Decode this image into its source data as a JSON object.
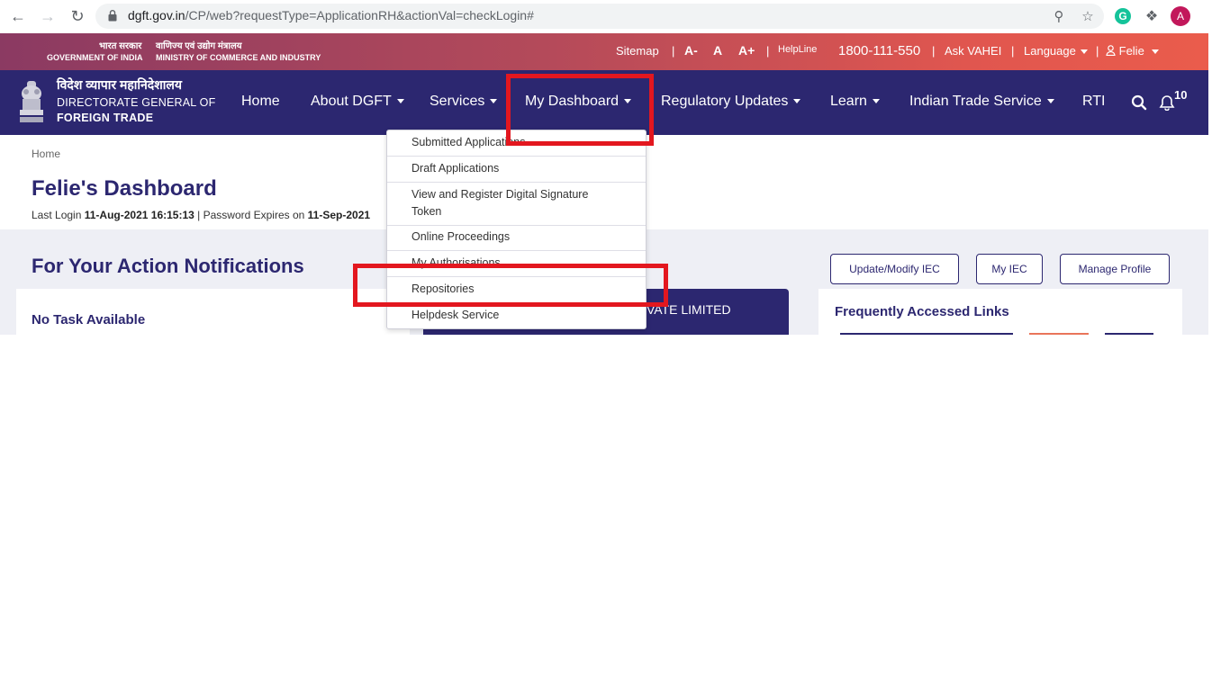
{
  "browser": {
    "url_host": "dgft.gov.in",
    "url_path": "/CP/web?requestType=ApplicationRH&actionVal=checkLogin#",
    "profile_initial": "A"
  },
  "gov_strip": {
    "hindi_govt": "भारत सरकार",
    "hindi_ministry": "वाणिज्य एवं उद्योग मंत्रालय",
    "govt": "GOVERNMENT OF INDIA",
    "ministry": "MINISTRY OF COMMERCE AND INDUSTRY",
    "sitemap": "Sitemap",
    "font_small": "A-",
    "font_normal": "A",
    "font_large": "A+",
    "helpline_label": "HelpLine",
    "helpline_number": "1800-111-550",
    "ask": "Ask VAHEI",
    "language": "Language",
    "user": "Felie",
    "sep": "|"
  },
  "brand": {
    "hindi": "विदेश व्यापार महानिदेशालय",
    "line2": "DIRECTORATE GENERAL OF",
    "line3": "FOREIGN TRADE"
  },
  "nav": {
    "home": "Home",
    "about": "About DGFT",
    "services": "Services",
    "dashboard": "My Dashboard",
    "regulatory": "Regulatory Updates",
    "learn": "Learn",
    "its": "Indian Trade Service",
    "rti": "RTI",
    "notif_count": "10"
  },
  "dropdown": {
    "items": [
      "Submitted Applications",
      "Draft Applications",
      "View and Register Digital Signature",
      "Token",
      "Online Proceedings",
      "My Authorisations",
      "Repositories",
      "Helpdesk Service"
    ]
  },
  "page": {
    "breadcrumb": "Home",
    "title": "Felie's Dashboard",
    "last_login_label": "Last Login",
    "last_login_value": "11-Aug-2021 16:15:13",
    "pw_label": "| Password Expires on",
    "pw_value": "11-Sep-2021",
    "notif_title": "For Your Action Notifications",
    "btn_update": "Update/Modify IEC",
    "btn_myiec": "My IEC",
    "btn_profile": "Manage Profile",
    "no_task": "No Task Available",
    "company_fragment": "VATE LIMITED",
    "links_title": "Frequently Accessed Links"
  },
  "colors": {
    "nav_bg": "#2c2770",
    "highlight": "#e3171f",
    "strip_start": "#8b3a62",
    "strip_end": "#ea5c4c"
  }
}
